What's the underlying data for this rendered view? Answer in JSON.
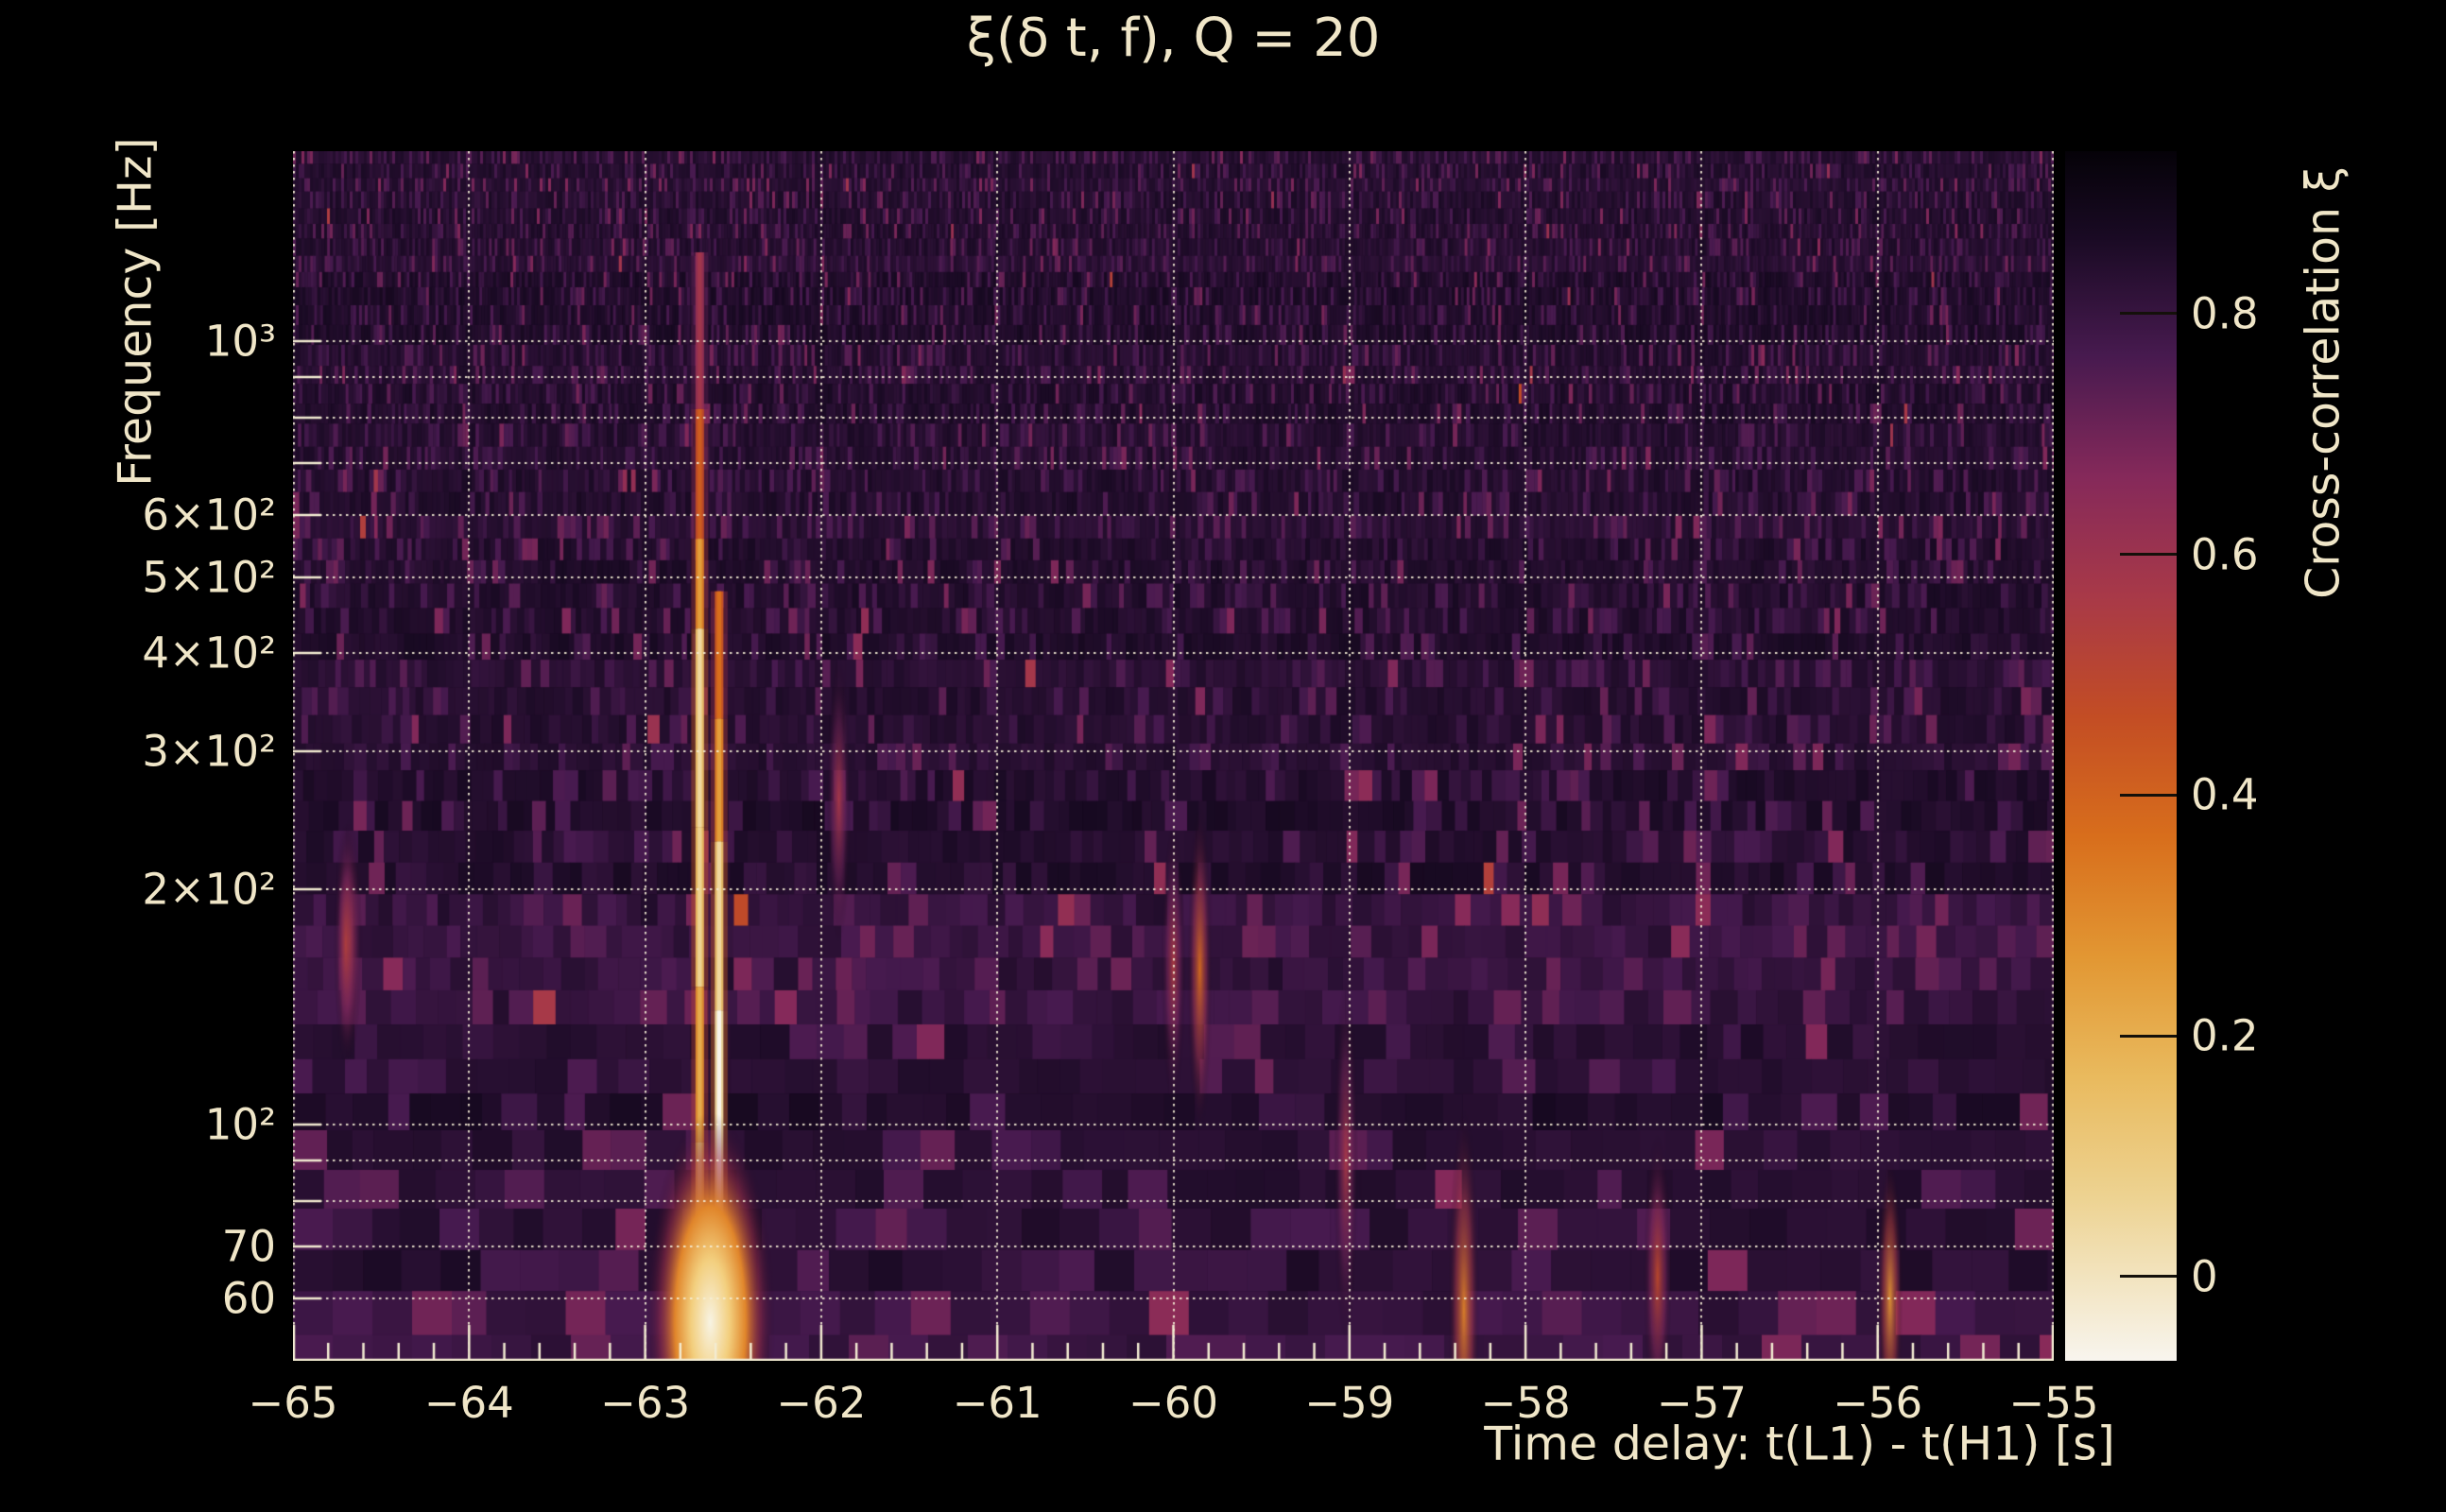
{
  "chart_data": {
    "type": "heatmap",
    "title": "ξ(δ t, f), Q = 20",
    "xlabel": "Time delay: t(L1) - t(H1) [s]",
    "ylabel": "Frequency [Hz]",
    "x_range": [
      -65,
      -55
    ],
    "x_major_ticks": [
      {
        "value": -65,
        "label": "−65"
      },
      {
        "value": -64,
        "label": "−64"
      },
      {
        "value": -63,
        "label": "−63"
      },
      {
        "value": -62,
        "label": "−62"
      },
      {
        "value": -61,
        "label": "−61"
      },
      {
        "value": -60,
        "label": "−60"
      },
      {
        "value": -59,
        "label": "−59"
      },
      {
        "value": -58,
        "label": "−58"
      },
      {
        "value": -57,
        "label": "−57"
      },
      {
        "value": -56,
        "label": "−56"
      },
      {
        "value": -55,
        "label": "−55"
      }
    ],
    "x_minor_tick_step": 0.2,
    "y_scale": "log",
    "y_range_hz": [
      50,
      1750
    ],
    "y_gridlines_hz": [
      60,
      70,
      80,
      90,
      100,
      200,
      300,
      400,
      500,
      600,
      700,
      800,
      900,
      1000
    ],
    "y_ticks": [
      {
        "hz": 1000,
        "label": "10³"
      },
      {
        "hz": 600,
        "label": "6×10²"
      },
      {
        "hz": 500,
        "label": "5×10²"
      },
      {
        "hz": 400,
        "label": "4×10²"
      },
      {
        "hz": 300,
        "label": "3×10²"
      },
      {
        "hz": 200,
        "label": "2×10²"
      },
      {
        "hz": 100,
        "label": "10²"
      },
      {
        "hz": 70,
        "label": "70"
      },
      {
        "hz": 60,
        "label": "60"
      }
    ],
    "grid": true,
    "colorbar": {
      "label": "Cross-correlation ξ",
      "vmin": -0.07,
      "vmax": 0.935,
      "ticks": [
        {
          "value": 0.8,
          "label": "0.8"
        },
        {
          "value": 0.6,
          "label": "0.6"
        },
        {
          "value": 0.4,
          "label": "0.4"
        },
        {
          "value": 0.2,
          "label": "0.2"
        },
        {
          "value": 0.0,
          "label": "0"
        }
      ],
      "colormap": "inferno-like",
      "stops": [
        {
          "t": 0.0,
          "hex": "#050208"
        },
        {
          "t": 0.07,
          "hex": "#190a23"
        },
        {
          "t": 0.169,
          "hex": "#471a4f"
        },
        {
          "t": 0.269,
          "hex": "#85295a"
        },
        {
          "t": 0.368,
          "hex": "#a83948"
        },
        {
          "t": 0.468,
          "hex": "#c34d24"
        },
        {
          "t": 0.567,
          "hex": "#d86e1c"
        },
        {
          "t": 0.667,
          "hex": "#e29733"
        },
        {
          "t": 0.766,
          "hex": "#e9ba5e"
        },
        {
          "t": 0.866,
          "hex": "#edd392"
        },
        {
          "t": 1.0,
          "hex": "#f8f5ee"
        }
      ]
    },
    "text_color": "#f0e6c8",
    "grid_color": "#f5eed6",
    "background_color": "#000000",
    "noise_bands": [
      {
        "f_lo": 135,
        "f_hi": 200,
        "boost": 0.05
      },
      {
        "f_lo": 50,
        "f_hi": 64,
        "boost": 0.045
      }
    ],
    "features": {
      "lines": [
        {
          "x": -62.69,
          "segments": [
            [
              1300,
              820,
              0.28
            ],
            [
              820,
              560,
              0.45
            ],
            [
              560,
              430,
              0.62
            ],
            [
              430,
              240,
              0.82
            ],
            [
              240,
              150,
              0.8
            ],
            [
              150,
              95,
              0.66
            ],
            [
              95,
              50,
              0.75
            ]
          ]
        },
        {
          "x": -62.58,
          "segments": [
            [
              480,
              330,
              0.5
            ],
            [
              330,
              230,
              0.62
            ],
            [
              230,
              140,
              0.82
            ],
            [
              140,
              60,
              0.93
            ],
            [
              60,
              50,
              0.85
            ]
          ]
        }
      ],
      "blob": {
        "x": -62.63,
        "f_center": 56,
        "f_lo": 50,
        "f_hi": 85,
        "peak_value": 0.95
      },
      "blips": [
        {
          "x": -64.68,
          "f": 172,
          "v": 0.35,
          "w_s": 0.09,
          "f_ratio": 1.25
        },
        {
          "x": -59.85,
          "f": 158,
          "v": 0.5,
          "w_s": 0.06,
          "f_ratio": 1.35
        },
        {
          "x": -59.02,
          "f": 90,
          "v": 0.3,
          "w_s": 0.05,
          "f_ratio": 1.4
        },
        {
          "x": -58.35,
          "f": 58,
          "v": 0.55,
          "w_s": 0.11,
          "f_ratio": 1.45
        },
        {
          "x": -57.25,
          "f": 64,
          "v": 0.38,
          "w_s": 0.1,
          "f_ratio": 1.3
        },
        {
          "x": -55.93,
          "f": 60,
          "v": 0.6,
          "w_s": 0.09,
          "f_ratio": 1.3
        },
        {
          "x": -60.0,
          "f": 160,
          "v": 0.32,
          "w_s": 0.05,
          "f_ratio": 1.3
        },
        {
          "x": -61.9,
          "f": 260,
          "v": 0.3,
          "w_s": 0.04,
          "f_ratio": 1.3
        },
        {
          "x": -64.7,
          "f": 170,
          "v": 0.33,
          "w_s": 0.05,
          "f_ratio": 1.25
        }
      ]
    }
  }
}
